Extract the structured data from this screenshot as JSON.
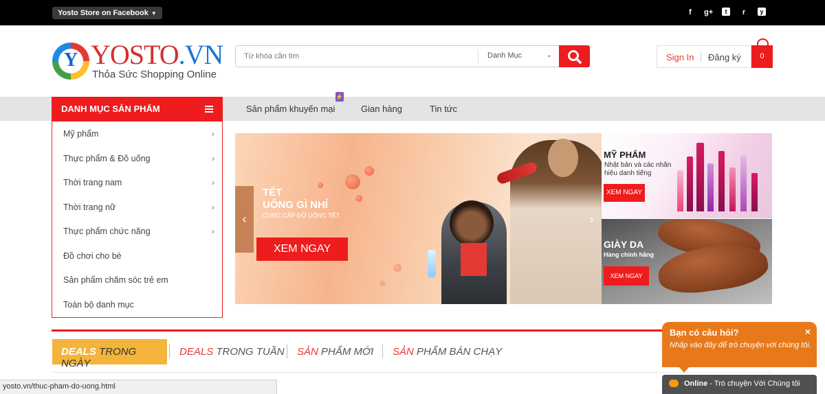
{
  "topbar": {
    "facebook_label": "Yosto Store on Facebook",
    "social_icons": [
      "facebook-icon",
      "google-plus-icon",
      "twitter-icon",
      "rss-icon",
      "youtube-icon"
    ],
    "social_glyphs": [
      "f",
      "g+",
      "t",
      "r",
      "y"
    ]
  },
  "header": {
    "logo_brand": "YOSTO",
    "logo_tld": ".VN",
    "logo_mark": "Y",
    "logo_tagline": "Thỏa Sức Shopping Online",
    "search_placeholder": "Từ khóa cần tìm",
    "search_category": "Danh Mục",
    "sign_in": "Sign In",
    "register": "Đăng ký",
    "cart_count": "0"
  },
  "nav": {
    "category_title": "DANH MỤC SẢN PHẨM",
    "items": [
      "Sản phẩm khuyến mại",
      "Gian hàng",
      "Tin tức"
    ]
  },
  "categories": [
    {
      "label": "Mỹ phẩm",
      "chevron": "›"
    },
    {
      "label": "Thực phẩm & Đồ uống",
      "chevron": "›"
    },
    {
      "label": "Thời trang nam",
      "chevron": "›"
    },
    {
      "label": "Thời trang nữ",
      "chevron": "›"
    },
    {
      "label": "Thực phẩm chức năng",
      "chevron": "›"
    },
    {
      "label": "Đồ chơi cho bé",
      "chevron": ""
    },
    {
      "label": "Sản phẩm chăm sóc trẻ em",
      "chevron": ""
    },
    {
      "label": "Toàn bộ danh mục",
      "chevron": ""
    }
  ],
  "hero": {
    "title_line1": "TẾT",
    "title_line2": "UỐNG GÌ NHỈ",
    "subtitle": "CUNG CẤP ĐỒ UỐNG TẾT",
    "cta": "XEM NGAY",
    "prev": "‹",
    "next": "›"
  },
  "promos": [
    {
      "title": "MỸ PHẨM",
      "subtitle": "Nhật bản và các nhãn hiệu danh tiếng",
      "cta": "XEM NGAY"
    },
    {
      "title": "GIÀY DA",
      "subtitle": "Hàng chính hãng",
      "cta": "XEM NGAY"
    }
  ],
  "deals": {
    "active": {
      "accent": "DEALS",
      "rest": "TRONG NGÀY"
    },
    "tabs": [
      {
        "accent": "DEALS",
        "rest": " TRONG TUẦN"
      },
      {
        "accent": "SẢN",
        "rest": " PHẨM MỚI"
      },
      {
        "accent": "SẢN",
        "rest": " PHẨM BÁN CHẠY"
      }
    ]
  },
  "status_url": "yosto.vn/thuc-pham-do-uong.html",
  "chat": {
    "question": "Bạn có câu hỏi?",
    "close": "×",
    "description": "Nhấp vào đây để trò chuyện với chúng tôi.",
    "online": "Online",
    "online_rest": " - Trò chuyện Với Chúng tôi"
  },
  "colors": {
    "accent_red": "#ee1c1c",
    "deal_yellow": "#f4b43c",
    "chat_orange": "#e8791b"
  }
}
